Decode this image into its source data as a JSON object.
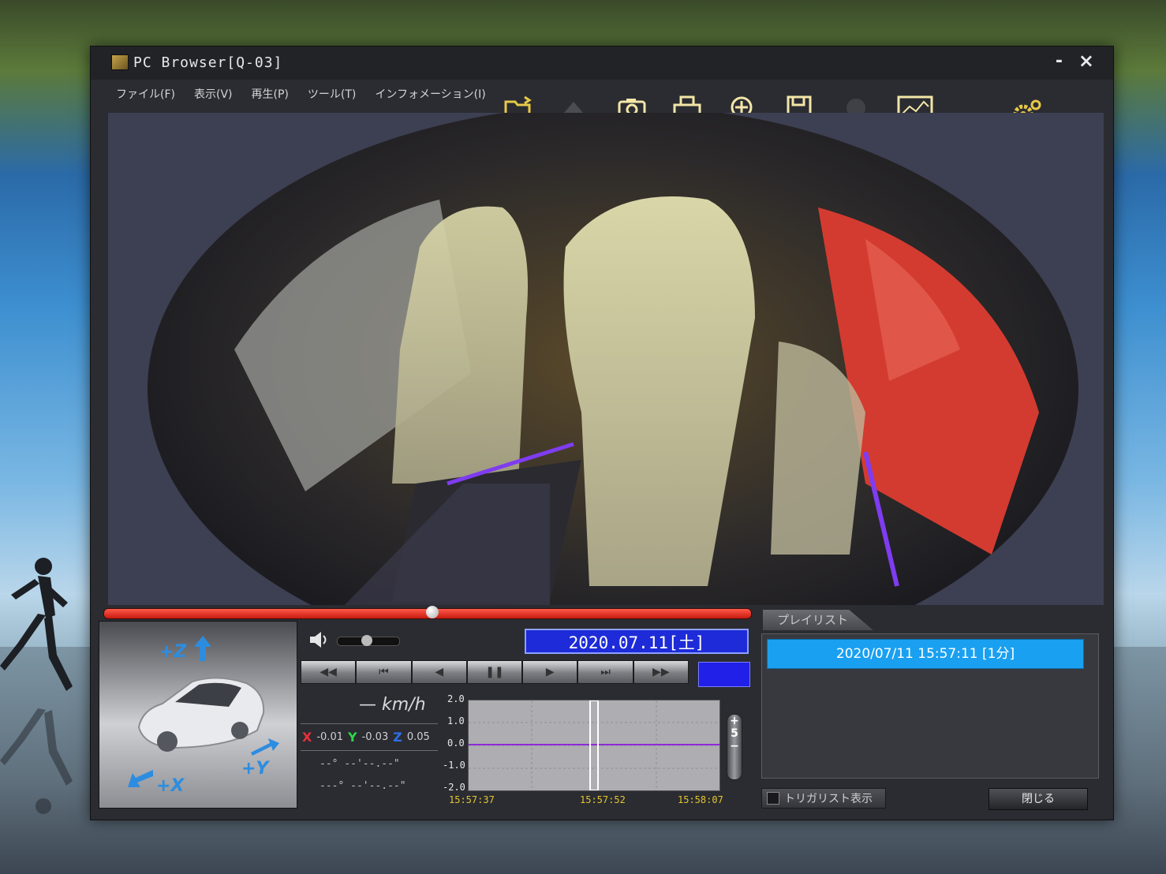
{
  "window": {
    "title": "PC Browser[Q-03]",
    "minimize": "-",
    "close": "×"
  },
  "menu": [
    {
      "label": "ファイル(F)"
    },
    {
      "label": "表示(V)"
    },
    {
      "label": "再生(P)"
    },
    {
      "label": "ツール(T)"
    },
    {
      "label": "インフォメーション(I)"
    }
  ],
  "toolbar": {
    "icons": [
      "open-folder-icon",
      "eject-icon",
      "camera-icon",
      "print-icon",
      "zoom-move-icon",
      "save-icon",
      "disc-icon",
      "map-icon",
      "settings-icon"
    ]
  },
  "seek": {
    "progress": 0.5
  },
  "playback": {
    "datetime": "2020.07.11[土] 15:57:52",
    "buttons": [
      "◀◀",
      "⏮",
      "◀",
      "❚❚",
      "▶",
      "⏭",
      "▶▶"
    ],
    "volume": 0.45
  },
  "sensors": {
    "speed": "— km/h",
    "x_label": "X",
    "x_value": "-0.01",
    "y_label": "Y",
    "y_value": "-0.03",
    "z_label": "Z",
    "z_value": "0.05",
    "coord1": "--°  --'--.--\"",
    "coord2": "---°  --'--.--\""
  },
  "car_panel": {
    "z_label": "+Z",
    "y_label": "+Y",
    "x_label": "+X"
  },
  "graph": {
    "y_ticks": [
      "2.0",
      "1.0",
      "0.0",
      "-1.0",
      "-2.0"
    ],
    "x_ticks": [
      "15:57:37",
      "15:57:52",
      "15:58:07"
    ],
    "zoom_plus": "+",
    "zoom_mid": "5",
    "zoom_minus": "−"
  },
  "playlist": {
    "tab_label": "プレイリスト",
    "items": [
      {
        "label": "2020/07/11 15:57:11 [1分]"
      }
    ],
    "trigger_label": "トリガリスト表示",
    "close_label": "閉じる"
  },
  "colors": {
    "seek": "#e0281a",
    "datetime_bg": "#1e2bd8",
    "playlist_selected": "#1aa0f0"
  }
}
